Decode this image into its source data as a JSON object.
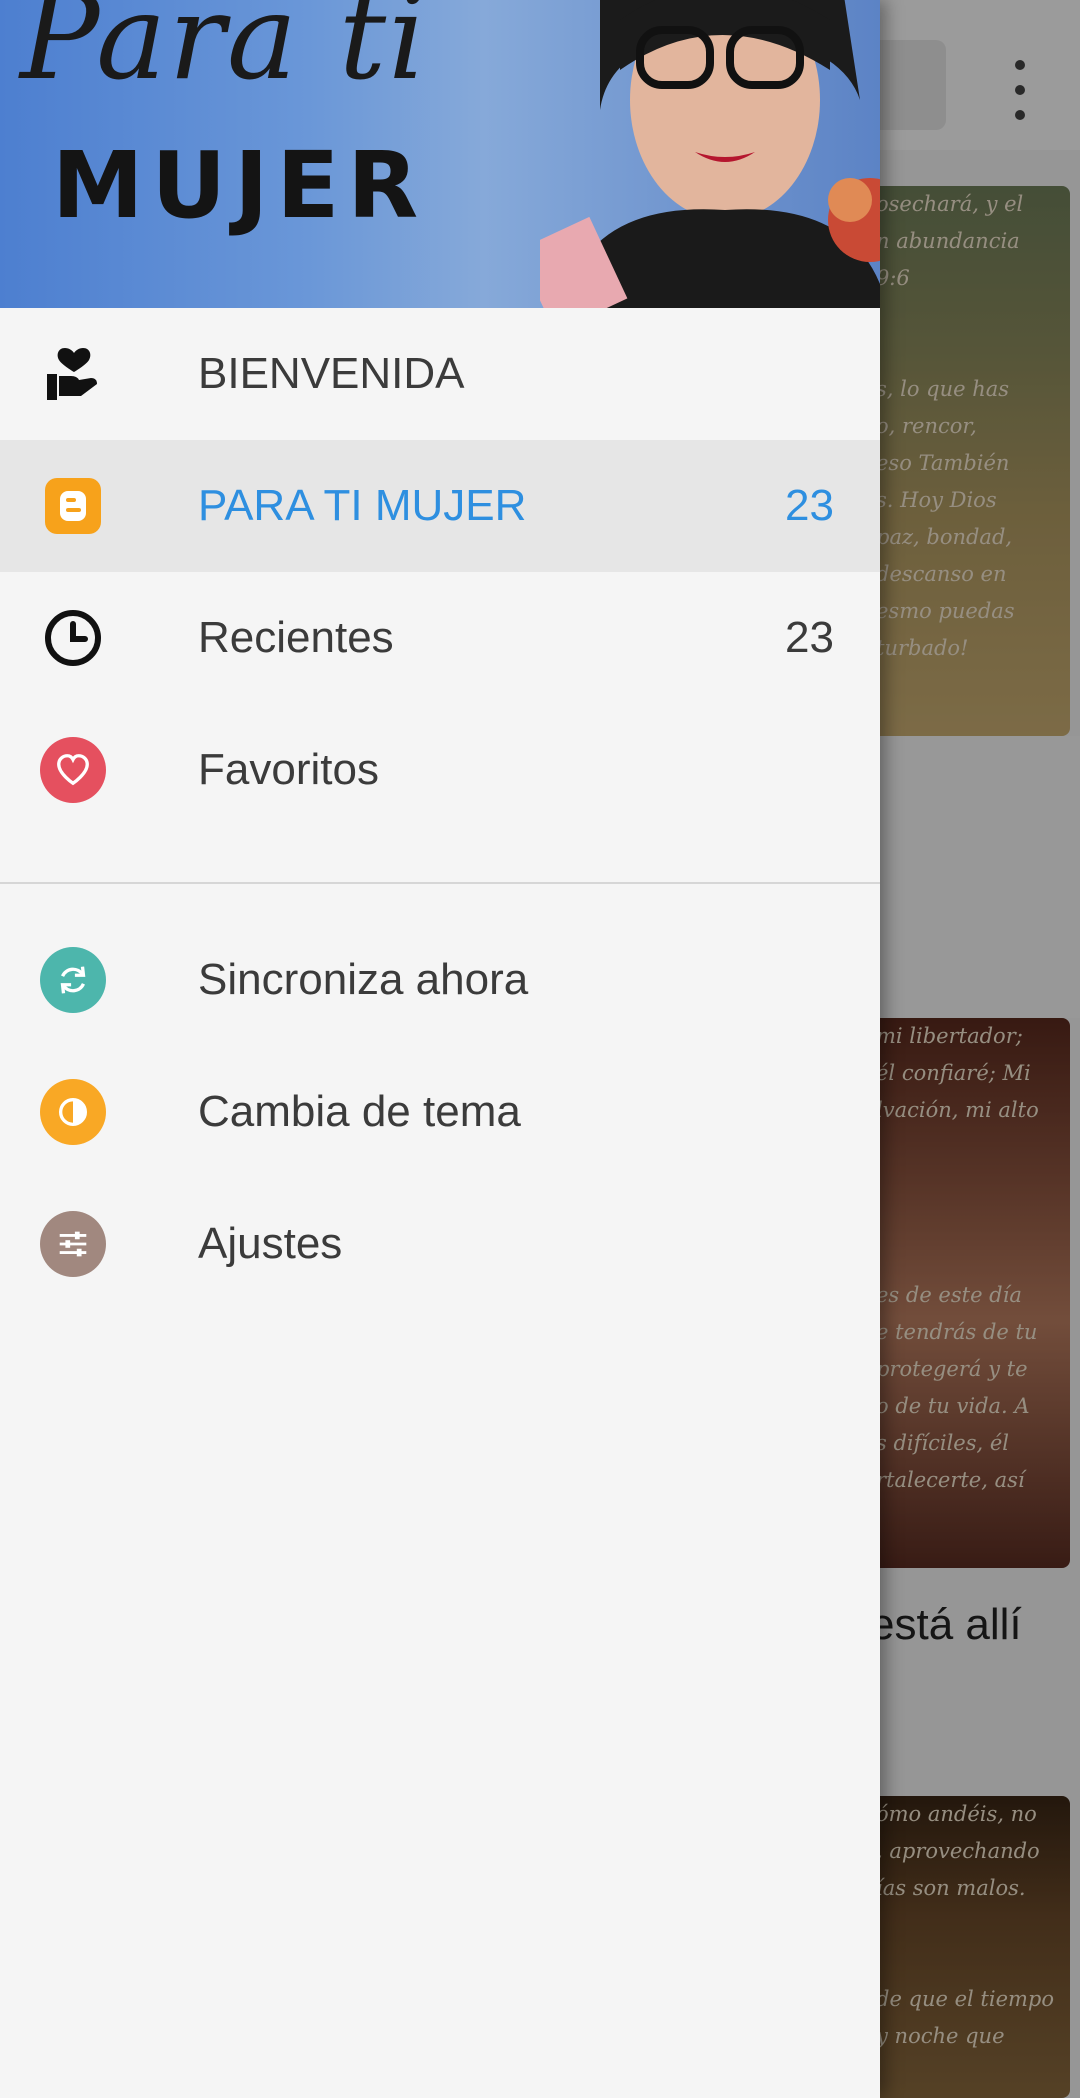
{
  "drawer": {
    "header": {
      "script_text": "Para ti",
      "title": "MUJER"
    },
    "primary_items": [
      {
        "label": "BIENVENIDA",
        "icon": "heart-hand-icon",
        "count": "",
        "selected": false
      },
      {
        "label": "PARA TI MUJER",
        "icon": "blogger-icon",
        "count": "23",
        "selected": true
      },
      {
        "label": "Recientes",
        "icon": "clock-icon",
        "count": "23",
        "selected": false
      },
      {
        "label": "Favoritos",
        "icon": "heart-icon",
        "count": "",
        "selected": false
      }
    ],
    "secondary_items": [
      {
        "label": "Sincroniza ahora",
        "icon": "sync-icon"
      },
      {
        "label": "Cambia de tema",
        "icon": "theme-icon"
      },
      {
        "label": "Ajustes",
        "icon": "sliders-icon"
      }
    ]
  },
  "background": {
    "card1_lines": [
      "osechará, y el",
      "n abundancia",
      "9:6",
      "",
      "",
      "s, lo que has",
      "o, rencor,",
      "eso También",
      "s. Hoy Dios",
      "paz, bondad,",
      "descanso en",
      "esmo puedas",
      "turbado!"
    ],
    "card2_lines": [
      "mi libertador;",
      "él confiaré; Mi",
      "lvación, mi alto",
      "",
      "",
      "",
      "",
      "es de este día",
      "e tendrás de tu",
      "protegerá y te",
      "o de tu vida. A",
      "s difíciles, él",
      "rtalecerte, así"
    ],
    "caption": "está allí",
    "card3_lines": [
      "ómo andéis, no",
      ", aprovechando",
      "ías son malos.",
      "",
      "",
      "de que el tiempo",
      "y noche que"
    ]
  },
  "colors": {
    "accent": "#2e8fe0",
    "blogger": "#f7a21b",
    "favorites": "#e5505f",
    "sync": "#4db6ac",
    "theme": "#f9a825",
    "settings": "#a1887f"
  }
}
